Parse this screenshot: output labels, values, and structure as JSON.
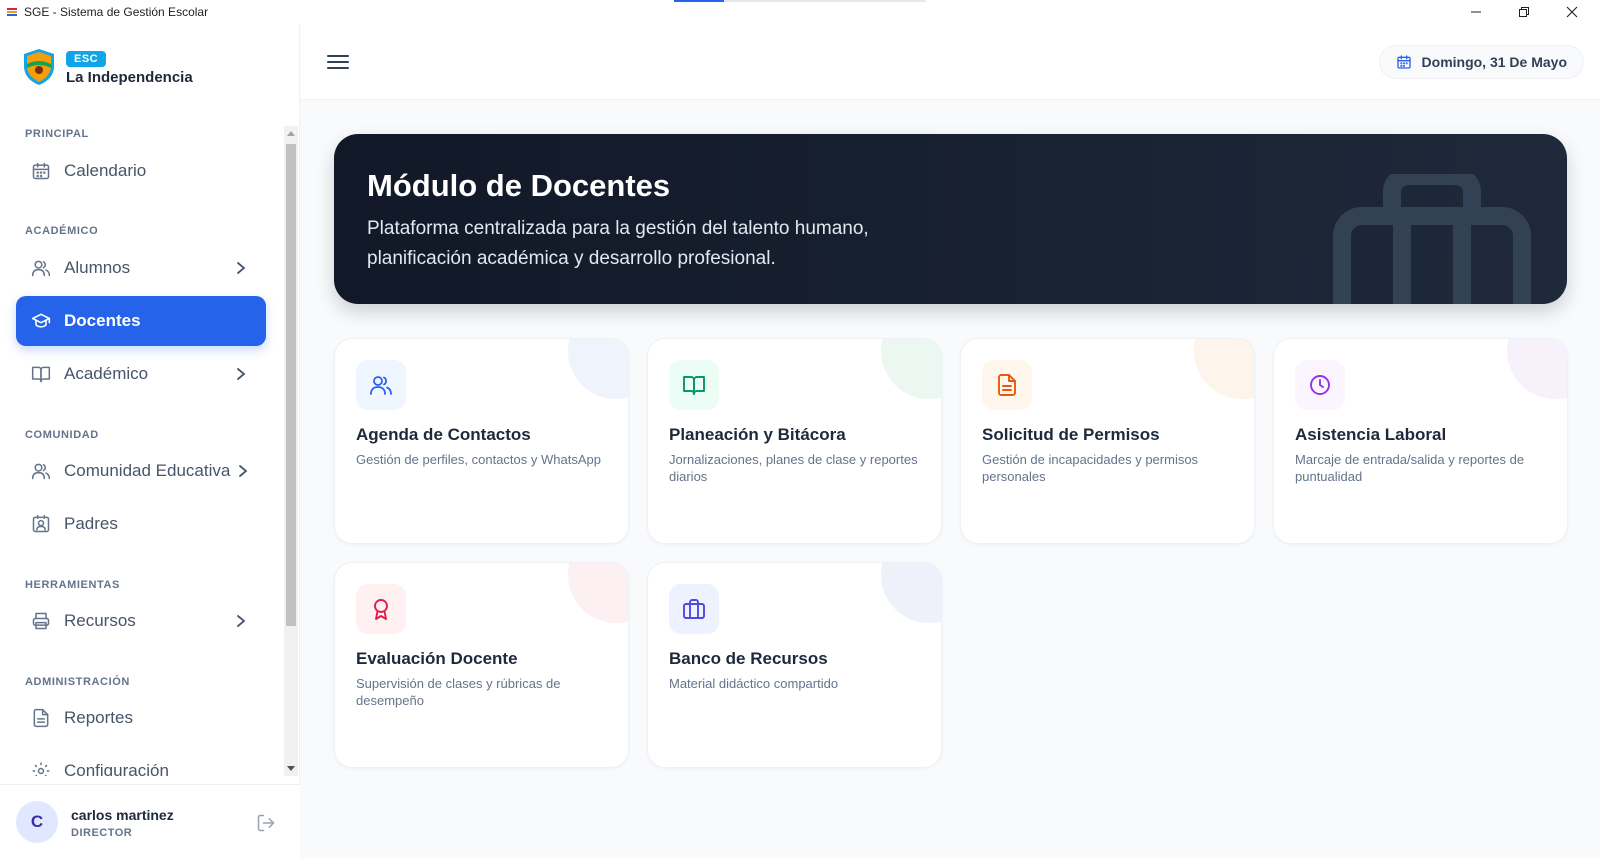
{
  "window": {
    "title": "SGE - Sistema de Gestión Escolar"
  },
  "brand": {
    "badge": "ESC",
    "school_name": "La Independencia"
  },
  "sidebar": {
    "sections": [
      {
        "title": "PRINCIPAL"
      },
      {
        "title": "ACADÉMICO"
      },
      {
        "title": "COMUNIDAD"
      },
      {
        "title": "HERRAMIENTAS"
      },
      {
        "title": "ADMINISTRACIÓN"
      }
    ],
    "items": [
      {
        "label": "Calendario",
        "icon": "calendar-icon"
      },
      {
        "label": "Alumnos",
        "icon": "users-icon",
        "has_submenu": true
      },
      {
        "label": "Docentes",
        "icon": "graduation-cap-icon",
        "active": true
      },
      {
        "label": "Académico",
        "icon": "book-open-icon",
        "has_submenu": true
      },
      {
        "label": "Comunidad Educativa",
        "icon": "users-icon",
        "has_submenu": true
      },
      {
        "label": "Padres",
        "icon": "contact-card-icon"
      },
      {
        "label": "Recursos",
        "icon": "printer-icon",
        "has_submenu": true
      },
      {
        "label": "Reportes",
        "icon": "file-text-icon"
      },
      {
        "label": "Configuración",
        "icon": "gear-icon"
      }
    ]
  },
  "user": {
    "initial": "C",
    "name": "carlos martinez",
    "role": "DIRECTOR"
  },
  "header": {
    "date": "Domingo, 31 De Mayo"
  },
  "hero": {
    "title": "Módulo de Docentes",
    "subtitle": "Plataforma centralizada para la gestión del talento humano, planificación académica y desarrollo profesional."
  },
  "cards": [
    {
      "title": "Agenda de Contactos",
      "description": "Gestión de perfiles, contactos y WhatsApp",
      "icon": "users-icon",
      "color": "#2563eb"
    },
    {
      "title": "Planeación y Bitácora",
      "description": "Jornalizaciones, planes de clase y reportes diarios",
      "icon": "book-open-icon",
      "color": "#059669"
    },
    {
      "title": "Solicitud de Permisos",
      "description": "Gestión de incapacidades y permisos personales",
      "icon": "file-text-icon",
      "color": "#ea580c"
    },
    {
      "title": "Asistencia Laboral",
      "description": "Marcaje de entrada/salida y reportes de puntualidad",
      "icon": "clock-icon",
      "color": "#9333ea"
    },
    {
      "title": "Evaluación Docente",
      "description": "Supervisión de clases y rúbricas de desempeño",
      "icon": "award-icon",
      "color": "#e11d48"
    },
    {
      "title": "Banco de Recursos",
      "description": "Material didáctico compartido",
      "icon": "briefcase-icon",
      "color": "#4f46e5"
    }
  ],
  "colors": {
    "accent": "#2563eb",
    "hero_bg": "#111827"
  }
}
